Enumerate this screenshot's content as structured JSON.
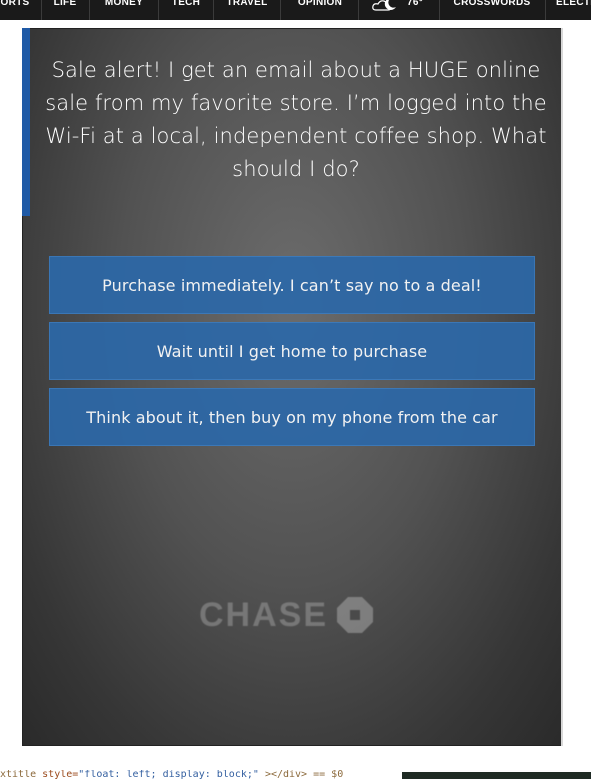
{
  "nav": {
    "items": [
      {
        "label": "ORTS"
      },
      {
        "label": "LIFE"
      },
      {
        "label": "MONEY"
      },
      {
        "label": "TECH"
      },
      {
        "label": "TRAVEL"
      },
      {
        "label": "OPINION"
      },
      {
        "label": "76°"
      },
      {
        "label": "CROSSWORDS"
      },
      {
        "label": "ELECTI"
      }
    ],
    "weather_icon": "cloud-moon-icon"
  },
  "ad": {
    "question": "Sale alert! I get an email about a HUGE online sale from my favorite store. I’m logged into the Wi-Fi at a local, independent coffee shop. What should I do?",
    "answers": [
      {
        "label": "Purchase immediately. I can’t say no to a deal!"
      },
      {
        "label": "Wait until I get home to purchase"
      },
      {
        "label": "Think about it, then buy on my phone from the car"
      }
    ],
    "brand": "CHASE",
    "accent_color": "#1f5aa6",
    "button_color": "#2c68a8"
  },
  "code_strip": {
    "t1": "xtitle",
    "t2": "style=",
    "t3": "\"float: left; display: block;\"",
    "t4": "></div>",
    "t5": "== $0"
  }
}
